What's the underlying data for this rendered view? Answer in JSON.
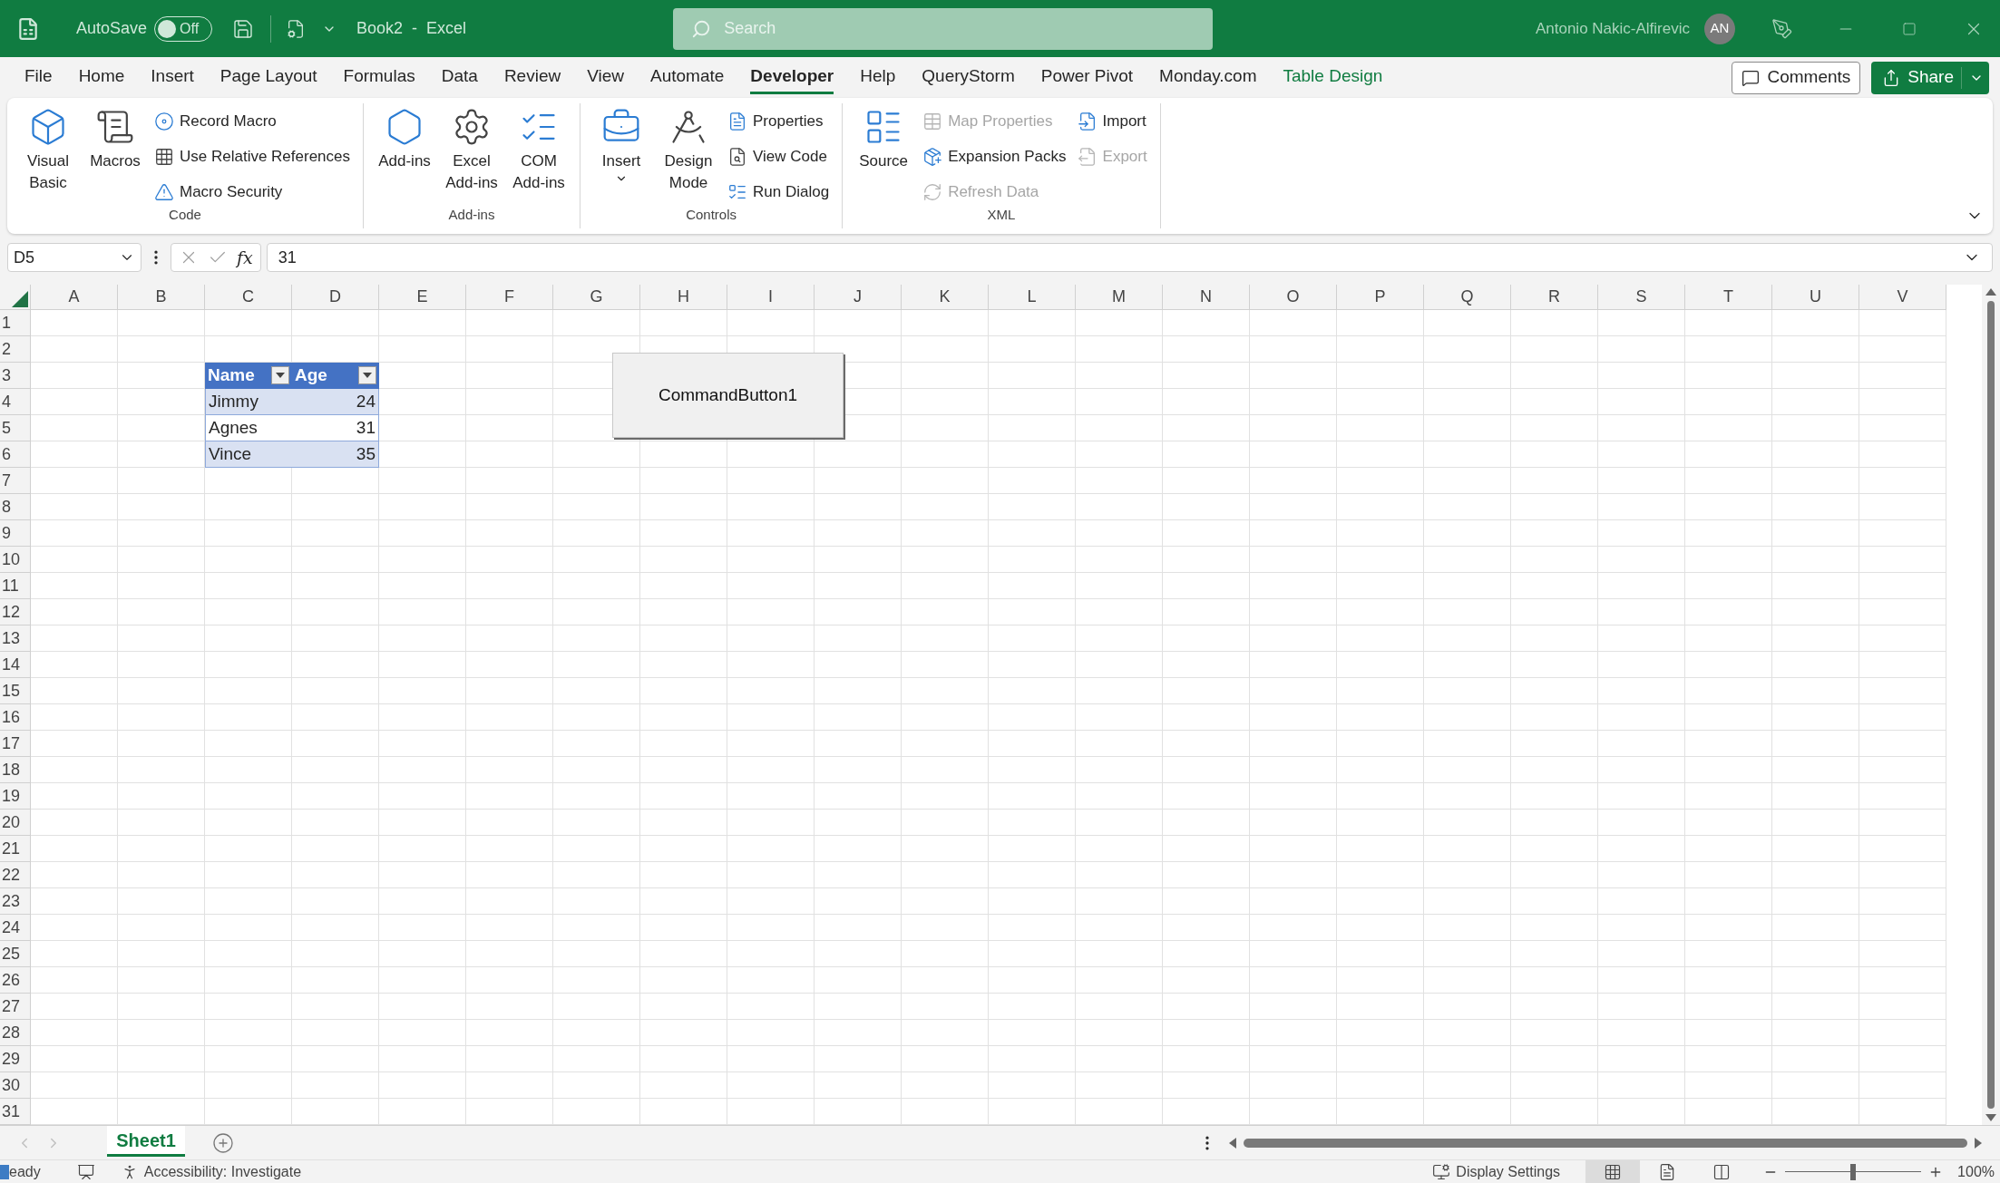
{
  "title_bar": {
    "autosave_label": "AutoSave",
    "autosave_toggle": {
      "label": "Off",
      "on": false
    },
    "document_title": "Book2  -  Excel",
    "search": {
      "placeholder": "Search"
    },
    "user_name": "Antonio Nakic-Alfirevic",
    "avatar_initials": "AN"
  },
  "ribbon_tabs": [
    {
      "label": "File",
      "selected": false,
      "kind": "normal"
    },
    {
      "label": "Home",
      "selected": false,
      "kind": "normal"
    },
    {
      "label": "Insert",
      "selected": false,
      "kind": "normal"
    },
    {
      "label": "Page Layout",
      "selected": false,
      "kind": "normal"
    },
    {
      "label": "Formulas",
      "selected": false,
      "kind": "normal"
    },
    {
      "label": "Data",
      "selected": false,
      "kind": "normal"
    },
    {
      "label": "Review",
      "selected": false,
      "kind": "normal"
    },
    {
      "label": "View",
      "selected": false,
      "kind": "normal"
    },
    {
      "label": "Automate",
      "selected": false,
      "kind": "normal"
    },
    {
      "label": "Developer",
      "selected": true,
      "kind": "normal"
    },
    {
      "label": "Help",
      "selected": false,
      "kind": "normal"
    },
    {
      "label": "QueryStorm",
      "selected": false,
      "kind": "normal"
    },
    {
      "label": "Power Pivot",
      "selected": false,
      "kind": "normal"
    },
    {
      "label": "Monday.com",
      "selected": false,
      "kind": "normal"
    },
    {
      "label": "Table Design",
      "selected": false,
      "kind": "contextual"
    }
  ],
  "comments_button": "Comments",
  "share_button": "Share",
  "ribbon_groups": [
    {
      "label": "Code",
      "items": [
        {
          "label": "Visual Basic",
          "kind": "large",
          "disabled": false,
          "dropdown": false
        },
        {
          "label": "Macros",
          "kind": "large",
          "disabled": false,
          "dropdown": false
        },
        {
          "label": "Record Macro",
          "kind": "small",
          "disabled": false
        },
        {
          "label": "Use Relative References",
          "kind": "small",
          "disabled": false
        },
        {
          "label": "Macro Security",
          "kind": "small",
          "disabled": false
        }
      ]
    },
    {
      "label": "Add-ins",
      "items": [
        {
          "label": "Add-ins",
          "kind": "large",
          "disabled": false,
          "dropdown": false
        },
        {
          "label": "Excel Add-ins",
          "kind": "large",
          "disabled": false,
          "dropdown": false
        },
        {
          "label": "COM Add-ins",
          "kind": "large",
          "disabled": false,
          "dropdown": false
        }
      ]
    },
    {
      "label": "Controls",
      "items": [
        {
          "label": "Insert",
          "kind": "large",
          "disabled": false,
          "dropdown": true
        },
        {
          "label": "Design Mode",
          "kind": "large",
          "disabled": false,
          "dropdown": false
        },
        {
          "label": "Properties",
          "kind": "small",
          "disabled": false
        },
        {
          "label": "View Code",
          "kind": "small",
          "disabled": false
        },
        {
          "label": "Run Dialog",
          "kind": "small",
          "disabled": false
        }
      ]
    },
    {
      "label": "XML",
      "items": [
        {
          "label": "Source",
          "kind": "large",
          "disabled": false,
          "dropdown": false
        },
        {
          "label": "Map Properties",
          "kind": "small",
          "disabled": true
        },
        {
          "label": "Expansion Packs",
          "kind": "small",
          "disabled": false
        },
        {
          "label": "Refresh Data",
          "kind": "small",
          "disabled": true
        },
        {
          "label": "Import",
          "kind": "small",
          "disabled": false
        },
        {
          "label": "Export",
          "kind": "small",
          "disabled": true
        }
      ]
    }
  ],
  "formula_bar": {
    "name_box": "D5",
    "function_label": "fx",
    "value": "31"
  },
  "columns": [
    "A",
    "B",
    "C",
    "D",
    "E",
    "F",
    "G",
    "H",
    "I",
    "J",
    "K",
    "L",
    "M",
    "N",
    "O",
    "P",
    "Q",
    "R",
    "S",
    "T",
    "U",
    "V"
  ],
  "rows": [
    "1",
    "2",
    "3",
    "4",
    "5",
    "6",
    "7",
    "8",
    "9",
    "10",
    "11",
    "12",
    "13",
    "14",
    "15",
    "16",
    "17",
    "18",
    "19",
    "20",
    "21",
    "22",
    "23",
    "24",
    "25",
    "26",
    "27",
    "28",
    "29",
    "30",
    "31"
  ],
  "table": {
    "columns": [
      "Name",
      "Age"
    ],
    "rows": [
      [
        "Jimmy",
        "24"
      ],
      [
        "Agnes",
        "31"
      ],
      [
        "Vince",
        "35"
      ]
    ]
  },
  "command_button": "CommandButton1",
  "sheet_tabs": [
    {
      "label": "Sheet1",
      "selected": true
    }
  ],
  "status_bar": {
    "mode": "eady",
    "accessibility": "Accessibility: Investigate",
    "display_settings": "Display Settings",
    "views": [
      {
        "selected": true
      },
      {
        "selected": false
      },
      {
        "selected": false
      }
    ],
    "zoom": {
      "level": 0.5,
      "reading": "100%"
    }
  }
}
